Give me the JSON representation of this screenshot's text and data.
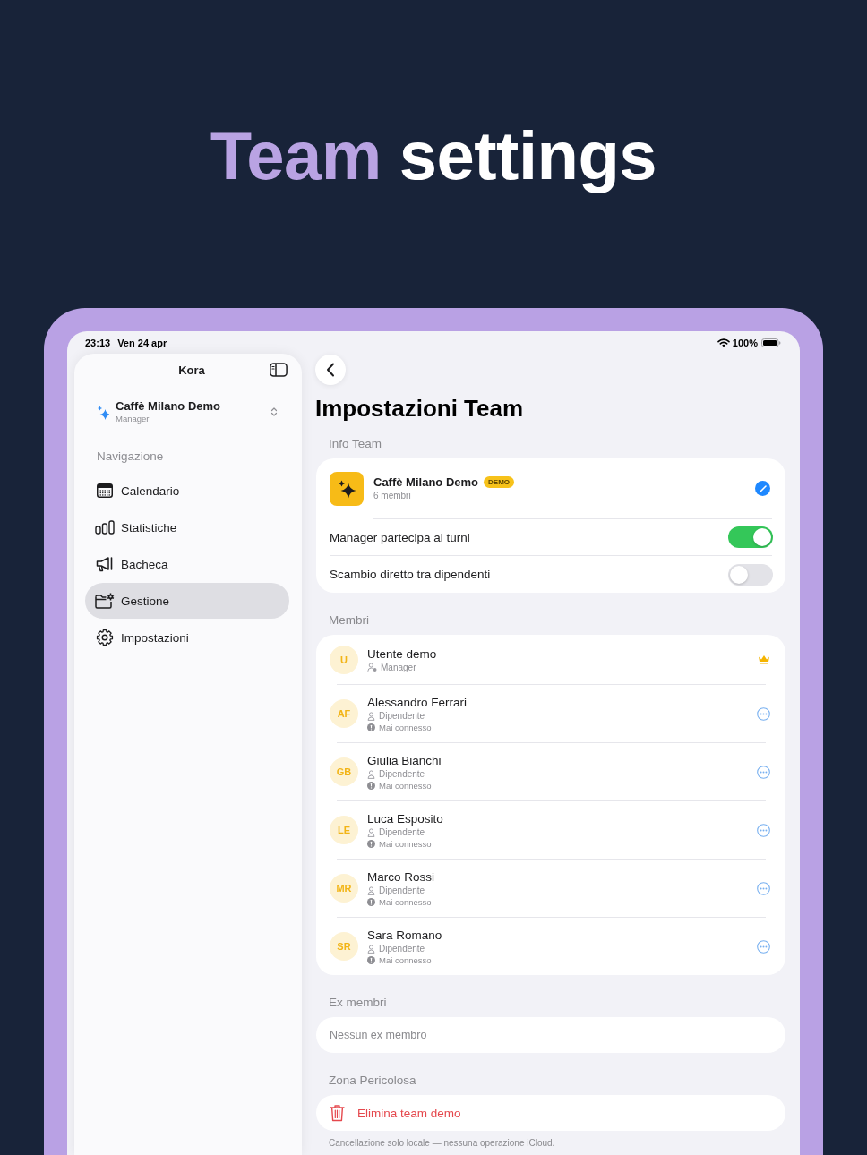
{
  "headline": {
    "highlight": "Team",
    "rest": "settings"
  },
  "status_bar": {
    "time": "23:13",
    "date": "Ven 24 apr",
    "battery": "100%"
  },
  "sidebar": {
    "title": "Kora",
    "team": {
      "name": "Caffè Milano Demo",
      "role": "Manager"
    },
    "section": "Navigazione",
    "items": [
      {
        "label": "Calendario",
        "selected": false
      },
      {
        "label": "Statistiche",
        "selected": false
      },
      {
        "label": "Bacheca",
        "selected": false
      },
      {
        "label": "Gestione",
        "selected": true
      },
      {
        "label": "Impostazioni",
        "selected": false
      }
    ]
  },
  "main": {
    "title": "Impostazioni Team",
    "info_team": {
      "header": "Info Team",
      "team": {
        "name": "Caffè Milano Demo",
        "badge": "DEMO",
        "members": "6 membri"
      },
      "toggles": [
        {
          "label": "Manager partecipa ai turni",
          "on": true
        },
        {
          "label": "Scambio diretto tra dipendenti",
          "on": false
        }
      ]
    },
    "members": {
      "header": "Membri",
      "items": [
        {
          "kind": "manager",
          "initials": "U",
          "name": "Utente demo",
          "role": "Manager"
        },
        {
          "kind": "employee",
          "initials": "AF",
          "name": "Alessandro Ferrari",
          "role": "Dipendente",
          "status": "Mai connesso"
        },
        {
          "kind": "employee",
          "initials": "GB",
          "name": "Giulia Bianchi",
          "role": "Dipendente",
          "status": "Mai connesso"
        },
        {
          "kind": "employee",
          "initials": "LE",
          "name": "Luca Esposito",
          "role": "Dipendente",
          "status": "Mai connesso"
        },
        {
          "kind": "employee",
          "initials": "MR",
          "name": "Marco Rossi",
          "role": "Dipendente",
          "status": "Mai connesso"
        },
        {
          "kind": "employee",
          "initials": "SR",
          "name": "Sara Romano",
          "role": "Dipendente",
          "status": "Mai connesso"
        }
      ]
    },
    "former_members": {
      "header": "Ex membri",
      "empty": "Nessun ex membro"
    },
    "danger_zone": {
      "header": "Zona Pericolosa",
      "action": "Elimina team demo",
      "note": "Cancellazione solo locale — nessuna operazione iCloud."
    }
  }
}
